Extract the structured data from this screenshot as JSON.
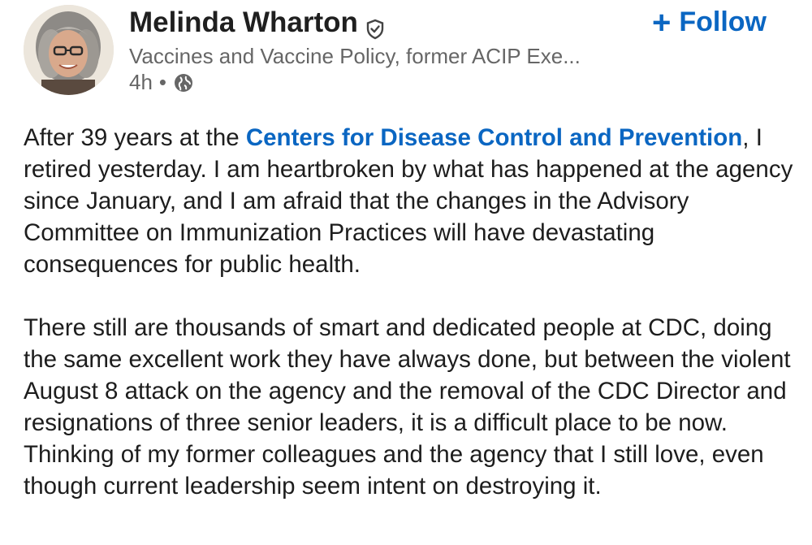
{
  "author": {
    "name": "Melinda Wharton",
    "headline": "Vaccines and Vaccine Policy, former ACIP Exe...",
    "time": "4h",
    "separator": "•",
    "verified_icon": "verified-shield-icon",
    "visibility_icon": "globe-icon"
  },
  "follow": {
    "icon": "+",
    "label": "Follow"
  },
  "post": {
    "p1_before": "After 39 years at the ",
    "p1_link": "Centers for Disease Control and Prevention",
    "p1_after": ", I retired yesterday.  I am heartbroken by what has happened at the agency since January, and I am afraid that the changes in the Advisory Committee on Immunization Practices will have devastating consequences for public health.",
    "p2": "There still are thousands of smart and dedicated people at CDC, doing the same excellent work they have always done, but between the violent August 8 attack on the agency and the removal of the CDC Director and resignations of three senior leaders, it is a difficult place to be now.  Thinking of my former colleagues and the agency that I still love, even though current leadership seem intent on destroying it."
  },
  "colors": {
    "link": "#0a66c2",
    "muted": "#666666",
    "text": "#1d1d1d"
  }
}
